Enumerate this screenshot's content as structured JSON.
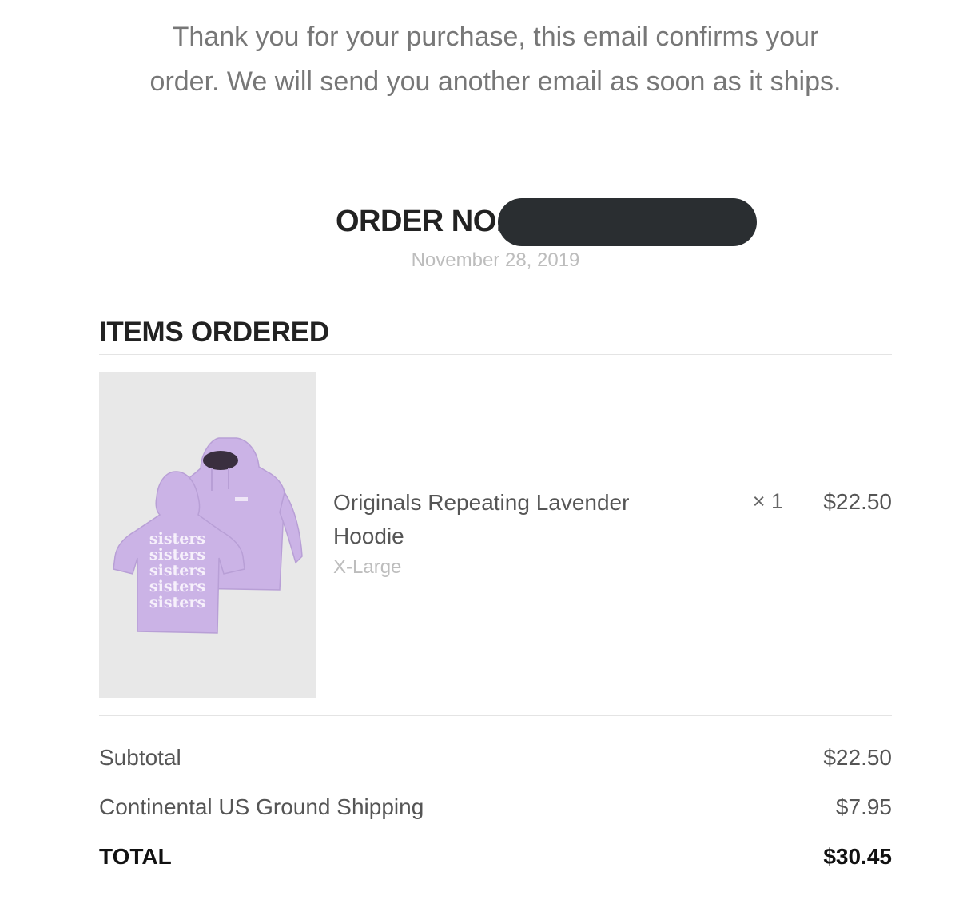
{
  "intro": {
    "line1": "Thank you for your purchase, this email confirms your",
    "line2": "order. We will send you another email as soon as it ships."
  },
  "order": {
    "label": "ORDER NO.",
    "date": "November 28, 2019"
  },
  "items_section": {
    "title": "ITEMS ORDERED"
  },
  "items": [
    {
      "name": "Originals Repeating Lavender Hoodie",
      "variant": "X-Large",
      "quantity": "× 1",
      "price": "$22.50",
      "image_print": "sisters"
    }
  ],
  "summary": {
    "subtotal_label": "Subtotal",
    "subtotal_value": "$22.50",
    "shipping_label": "Continental US Ground Shipping",
    "shipping_value": "$7.95",
    "total_label": "TOTAL",
    "total_value": "$30.45"
  },
  "colors": {
    "hoodie": "#cbb3e6",
    "hoodie_shade": "#b89fd6",
    "redaction": "#2a2e31",
    "image_bg": "#e8e8e8"
  }
}
